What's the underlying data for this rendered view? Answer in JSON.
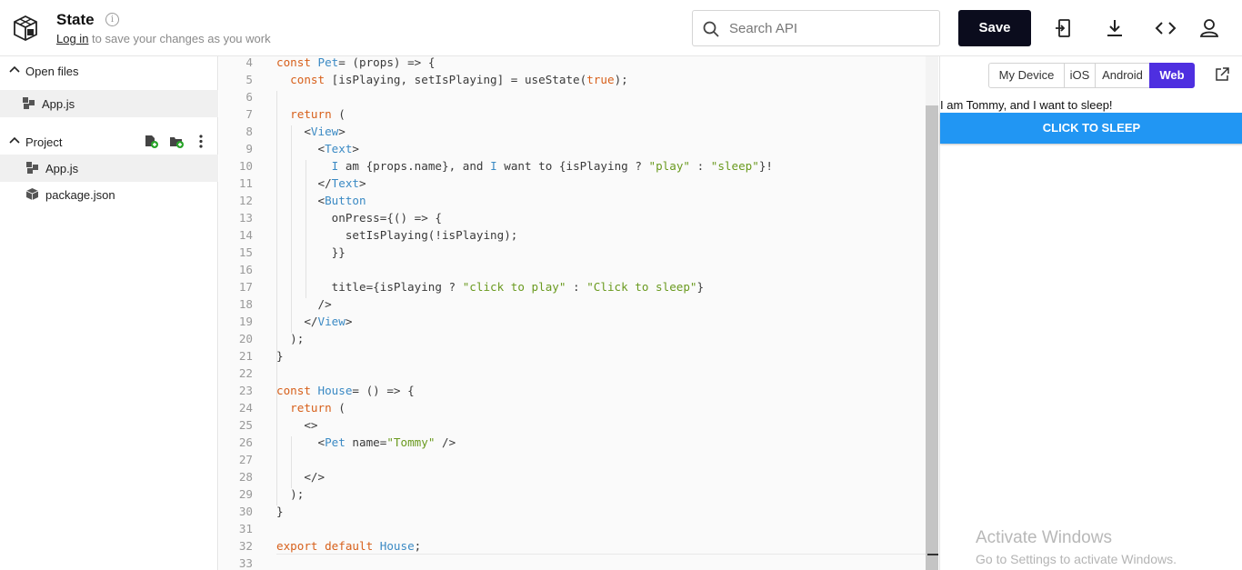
{
  "header": {
    "title": "State",
    "login_link": "Log in",
    "subtitle_rest": " to save your changes as you work",
    "info_icon_glyph": "i",
    "search_placeholder": "Search API",
    "save_label": "Save",
    "icons": [
      "logo-icon",
      "info-icon",
      "search-icon",
      "import-icon",
      "download-icon",
      "embed-code-icon",
      "profile-icon"
    ]
  },
  "sidebar": {
    "open_files_label": "Open files",
    "open_files": [
      {
        "name": "App.js"
      }
    ],
    "project_label": "Project",
    "project_files": [
      {
        "name": "App.js"
      },
      {
        "name": "package.json"
      }
    ]
  },
  "editor": {
    "lines": [
      {
        "n": "4",
        "segs": [
          [
            "kw",
            "const "
          ],
          [
            "tg",
            "Pet"
          ],
          [
            "",
            "= (props) => {"
          ]
        ]
      },
      {
        "n": "5",
        "segs": [
          [
            "",
            "  "
          ],
          [
            "kw",
            "const "
          ],
          [
            "",
            "[isPlaying, setIsPlaying] = useState("
          ],
          [
            "kw",
            "true"
          ],
          [
            "",
            ");"
          ]
        ]
      },
      {
        "n": "6",
        "segs": []
      },
      {
        "n": "7",
        "segs": [
          [
            "",
            "  "
          ],
          [
            "kw",
            "return"
          ],
          [
            "",
            " ("
          ]
        ]
      },
      {
        "n": "8",
        "segs": [
          [
            "",
            "    <"
          ],
          [
            "tg",
            "View"
          ],
          [
            "",
            ">"
          ]
        ]
      },
      {
        "n": "9",
        "segs": [
          [
            "",
            "      <"
          ],
          [
            "tg",
            "Text"
          ],
          [
            "",
            ">"
          ]
        ]
      },
      {
        "n": "10",
        "segs": [
          [
            "",
            "        "
          ],
          [
            "tg",
            "I"
          ],
          [
            "",
            " am {props.name}, and "
          ],
          [
            "tg",
            "I"
          ],
          [
            "",
            " want to {isPlaying ? "
          ],
          [
            "st",
            "\"play\""
          ],
          [
            "",
            " : "
          ],
          [
            "st",
            "\"sleep\""
          ],
          [
            "",
            "}!"
          ]
        ]
      },
      {
        "n": "11",
        "segs": [
          [
            "",
            "      </"
          ],
          [
            "tg",
            "Text"
          ],
          [
            "",
            ">"
          ]
        ]
      },
      {
        "n": "12",
        "segs": [
          [
            "",
            "      <"
          ],
          [
            "tg",
            "Button"
          ]
        ]
      },
      {
        "n": "13",
        "segs": [
          [
            "",
            "        onPress={() => {"
          ]
        ]
      },
      {
        "n": "14",
        "segs": [
          [
            "",
            "          setIsPlaying(!isPlaying);"
          ]
        ]
      },
      {
        "n": "15",
        "segs": [
          [
            "",
            "        }}"
          ]
        ]
      },
      {
        "n": "16",
        "segs": []
      },
      {
        "n": "17",
        "segs": [
          [
            "",
            "        title={isPlaying ? "
          ],
          [
            "st",
            "\"click to play\""
          ],
          [
            "",
            " : "
          ],
          [
            "st",
            "\"Click to sleep\""
          ],
          [
            "",
            "}"
          ]
        ]
      },
      {
        "n": "18",
        "segs": [
          [
            "",
            "      />"
          ]
        ]
      },
      {
        "n": "19",
        "segs": [
          [
            "",
            "    </"
          ],
          [
            "tg",
            "View"
          ],
          [
            "",
            ">"
          ]
        ]
      },
      {
        "n": "20",
        "segs": [
          [
            "",
            "  );"
          ]
        ]
      },
      {
        "n": "21",
        "segs": [
          [
            "",
            "}"
          ]
        ]
      },
      {
        "n": "22",
        "segs": []
      },
      {
        "n": "23",
        "segs": [
          [
            "kw",
            "const "
          ],
          [
            "tg",
            "House"
          ],
          [
            "",
            "= () => {"
          ]
        ]
      },
      {
        "n": "24",
        "segs": [
          [
            "",
            "  "
          ],
          [
            "kw",
            "return"
          ],
          [
            "",
            " ("
          ]
        ]
      },
      {
        "n": "25",
        "segs": [
          [
            "",
            "    <>"
          ]
        ]
      },
      {
        "n": "26",
        "segs": [
          [
            "",
            "      <"
          ],
          [
            "tg",
            "Pet"
          ],
          [
            "",
            " name="
          ],
          [
            "st",
            "\"Tommy\""
          ],
          [
            "",
            " />"
          ]
        ]
      },
      {
        "n": "27",
        "segs": []
      },
      {
        "n": "28",
        "segs": [
          [
            "",
            "    </>"
          ]
        ]
      },
      {
        "n": "29",
        "segs": [
          [
            "",
            "  );"
          ]
        ]
      },
      {
        "n": "30",
        "segs": [
          [
            "",
            "}"
          ]
        ]
      },
      {
        "n": "31",
        "segs": []
      },
      {
        "n": "32",
        "segs": [
          [
            "kw",
            "export "
          ],
          [
            "kw",
            "default "
          ],
          [
            "tg",
            "House"
          ],
          [
            "",
            ";"
          ]
        ]
      },
      {
        "n": "33",
        "segs": []
      }
    ]
  },
  "preview": {
    "platforms": [
      "My Device",
      "iOS",
      "Android",
      "Web"
    ],
    "selected_platform": "Web",
    "output_text": "I am Tommy, and I want to sleep!",
    "button_label": "CLICK TO SLEEP",
    "button_color": "#2196f3"
  },
  "watermark": {
    "line1": "Activate Windows",
    "line2": "Go to Settings to activate Windows."
  },
  "colors": {
    "save_button": "#0b0c1d",
    "active_tab": "#4e2fe0",
    "keyword": "#d7601b",
    "identifier": "#3b8ac4",
    "string": "#6a9a1f"
  }
}
